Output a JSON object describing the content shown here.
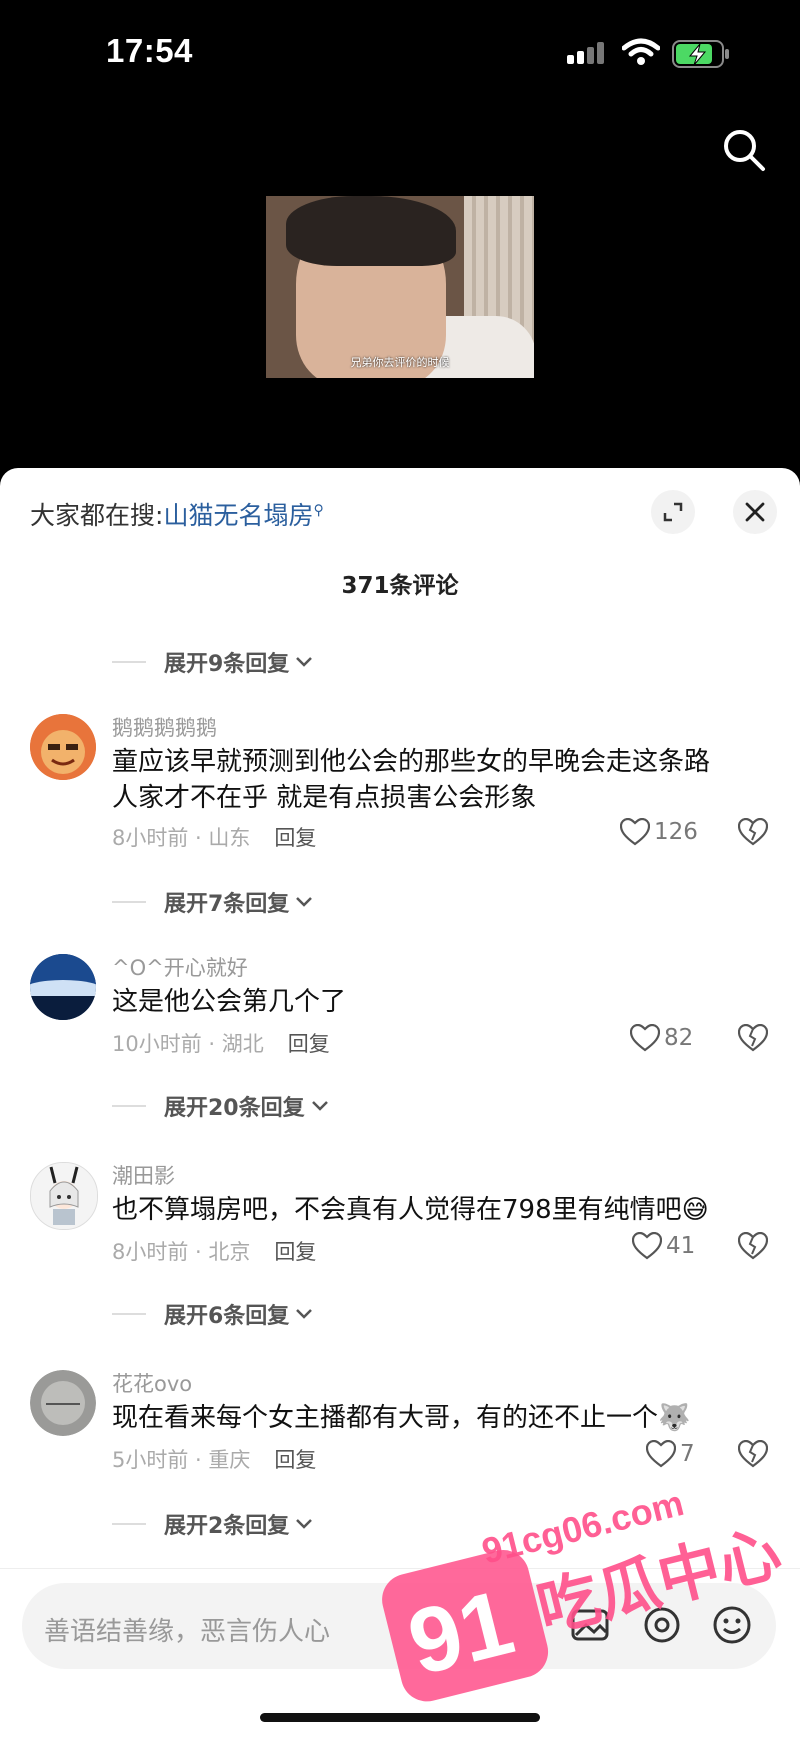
{
  "status": {
    "time": "17:54"
  },
  "video": {
    "caption": "兄弟你去评价的时候"
  },
  "sheet": {
    "hot_prefix": "大家都在搜:",
    "hot_link": "山猫无名塌房",
    "count": "371条评论"
  },
  "toggles": [
    "展开9条回复",
    "展开7条回复",
    "展开20条回复",
    "展开6条回复",
    "展开2条回复"
  ],
  "comments": [
    {
      "name": "鹅鹅鹅鹅鹅",
      "line1": "童应该早就预测到他公会的那些女的早晚会走这条路",
      "line2": "人家才不在乎 就是有点损害公会形象",
      "meta": "8小时前 · 山东",
      "reply": "回复",
      "likes": "126"
    },
    {
      "name": "^O^开心就好",
      "line1": "这是他公会第几个了",
      "line2": "",
      "meta": "10小时前 · 湖北",
      "reply": "回复",
      "likes": "82"
    },
    {
      "name": "潮田影",
      "line1": "也不算塌房吧，不会真有人觉得在798里有纯情吧😅",
      "line2": "",
      "meta": "8小时前 · 北京",
      "reply": "回复",
      "likes": "41"
    },
    {
      "name": "花花ovo",
      "line1": "现在看来每个女主播都有大哥，有的还不止一个🐺",
      "line2": "",
      "meta": "5小时前 · 重庆",
      "reply": "回复",
      "likes": "7"
    }
  ],
  "input": {
    "placeholder": "善语结善缘，恶言伤人心"
  },
  "watermark": {
    "number": "91",
    "domain": "91cg06.com",
    "brand": "吃瓜中心"
  },
  "colors": {
    "link": "#2b5f9e",
    "sheet_bg": "#ffffff",
    "top_bg": "#000000",
    "watermark": "#ff4f8a"
  }
}
